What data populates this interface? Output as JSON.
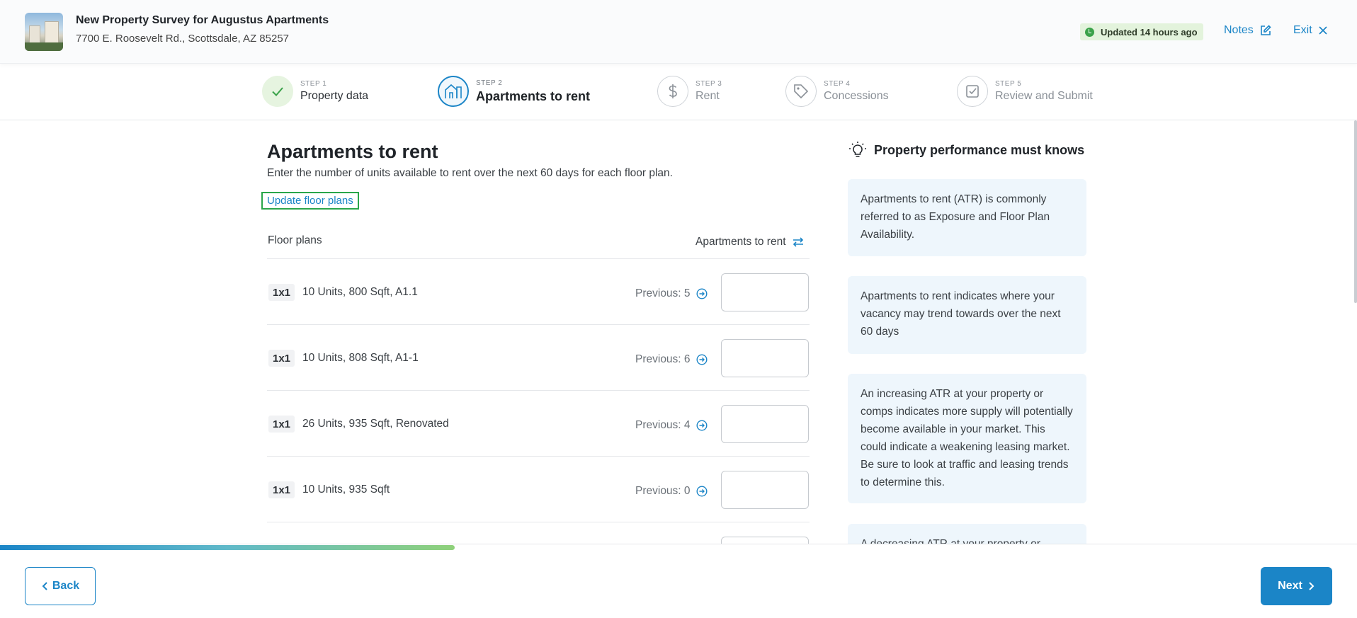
{
  "header": {
    "title": "New Property Survey for Augustus Apartments",
    "address": "7700 E. Roosevelt Rd., Scottsdale, AZ 85257",
    "updated": "Updated 14 hours ago",
    "notes_label": "Notes",
    "exit_label": "Exit"
  },
  "steps": [
    {
      "num": "STEP 1",
      "label": "Property data",
      "state": "done"
    },
    {
      "num": "STEP 2",
      "label": "Apartments to rent",
      "state": "active"
    },
    {
      "num": "STEP 3",
      "label": "Rent",
      "state": "pending"
    },
    {
      "num": "STEP 4",
      "label": "Concessions",
      "state": "pending"
    },
    {
      "num": "STEP 5",
      "label": "Review and Submit",
      "state": "pending"
    }
  ],
  "main": {
    "title": "Apartments to rent",
    "description": "Enter the number of units available to rent over the next 60 days for each floor plan.",
    "update_button": "Update floor plans",
    "col_floor_plans": "Floor plans",
    "col_atr": "Apartments to rent",
    "rows": [
      {
        "bed": "1x1",
        "desc": "10 Units, 800 Sqft, A1.1",
        "prev": "Previous: 5",
        "value": ""
      },
      {
        "bed": "1x1",
        "desc": "10 Units, 808 Sqft, A1-1",
        "prev": "Previous: 6",
        "value": ""
      },
      {
        "bed": "1x1",
        "desc": "26 Units, 935 Sqft, Renovated",
        "prev": "Previous: 4",
        "value": ""
      },
      {
        "bed": "1x1",
        "desc": "10 Units, 935 Sqft",
        "prev": "Previous: 0",
        "value": ""
      }
    ]
  },
  "side": {
    "heading": "Property performance must knows",
    "tips": [
      "Apartments to rent (ATR) is commonly referred to as Exposure and Floor Plan Availability.",
      "Apartments to rent indicates where your vacancy may trend towards over the next 60 days",
      "An increasing ATR at your property or comps indicates more supply will potentially become available in your market. This could indicate a weakening leasing market. Be sure to look at traffic and leasing trends to determine this.",
      "A decreasing ATR at your property or"
    ]
  },
  "footer": {
    "back_label": "Back",
    "next_label": "Next",
    "progress": 0.335
  },
  "colors": {
    "accent": "#1b85c7",
    "success": "#3aa24a"
  }
}
